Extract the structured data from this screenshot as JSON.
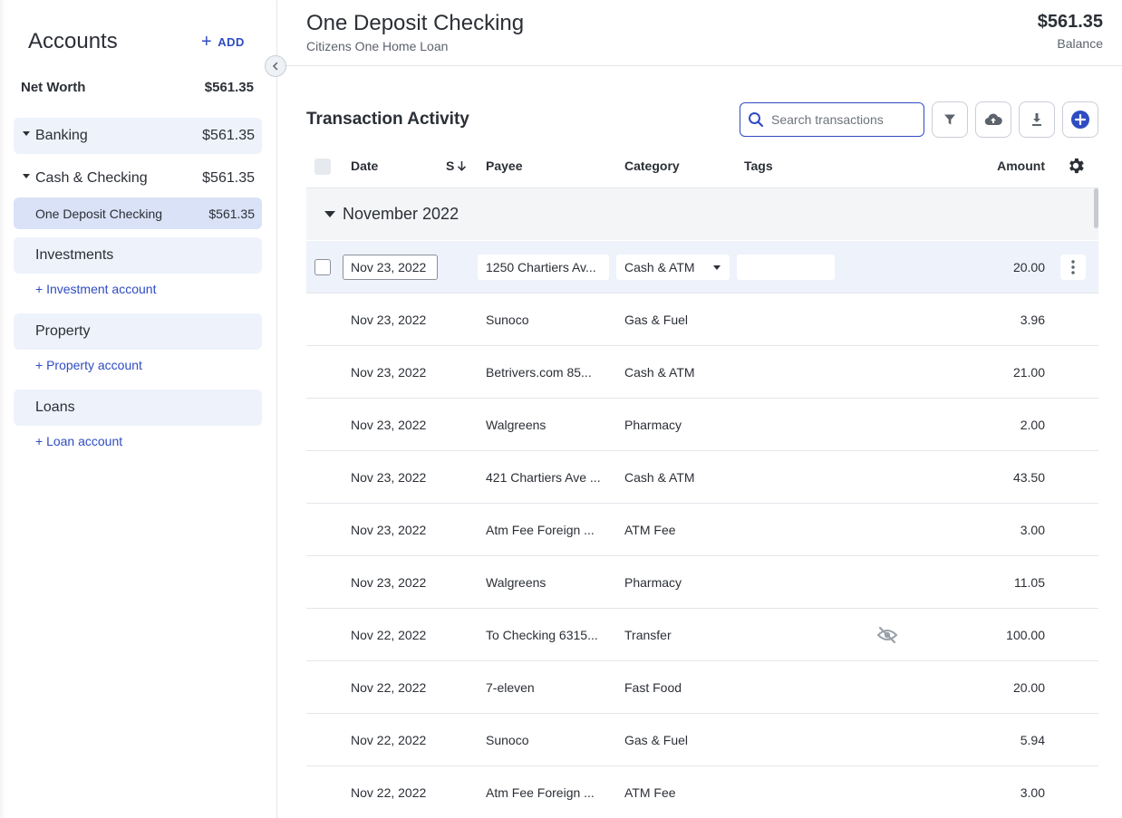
{
  "sidebar": {
    "title": "Accounts",
    "add_label": "ADD",
    "net_worth": {
      "label": "Net Worth",
      "amount": "$561.35"
    },
    "banking": {
      "label": "Banking",
      "amount": "$561.35"
    },
    "cash_checking": {
      "label": "Cash & Checking",
      "amount": "$561.35"
    },
    "selected_account": {
      "label": "One Deposit Checking",
      "amount": "$561.35"
    },
    "investments": {
      "label": "Investments",
      "add_link": "+ Investment account"
    },
    "property": {
      "label": "Property",
      "add_link": "+ Property account"
    },
    "loans": {
      "label": "Loans",
      "add_link": "+ Loan account"
    }
  },
  "header": {
    "account_name": "One Deposit Checking",
    "institution": "Citizens One Home Loan",
    "balance": "$561.35",
    "balance_label": "Balance"
  },
  "activity": {
    "title": "Transaction Activity",
    "search_placeholder": "Search transactions",
    "columns": {
      "date": "Date",
      "status": "S",
      "payee": "Payee",
      "category": "Category",
      "tags": "Tags",
      "amount": "Amount"
    },
    "month": "November 2022",
    "editing": {
      "date": "Nov 23, 2022",
      "payee": "1250 Chartiers Av...",
      "category": "Cash & ATM",
      "amount": "20.00"
    },
    "rows": [
      {
        "date": "Nov 23, 2022",
        "payee": "Sunoco",
        "category": "Gas & Fuel",
        "amount": "3.96"
      },
      {
        "date": "Nov 23, 2022",
        "payee": "Betrivers.com 85...",
        "category": "Cash & ATM",
        "amount": "21.00"
      },
      {
        "date": "Nov 23, 2022",
        "payee": "Walgreens",
        "category": "Pharmacy",
        "amount": "2.00"
      },
      {
        "date": "Nov 23, 2022",
        "payee": "421 Chartiers Ave ...",
        "category": "Cash & ATM",
        "amount": "43.50"
      },
      {
        "date": "Nov 23, 2022",
        "payee": "Atm Fee Foreign ...",
        "category": "ATM Fee",
        "amount": "3.00"
      },
      {
        "date": "Nov 23, 2022",
        "payee": "Walgreens",
        "category": "Pharmacy",
        "amount": "11.05"
      },
      {
        "date": "Nov 22, 2022",
        "payee": "To Checking 6315...",
        "category": "Transfer",
        "amount": "100.00",
        "icon": "hidden-eye-icon"
      },
      {
        "date": "Nov 22, 2022",
        "payee": "7-eleven",
        "category": "Fast Food",
        "amount": "20.00"
      },
      {
        "date": "Nov 22, 2022",
        "payee": "Sunoco",
        "category": "Gas & Fuel",
        "amount": "5.94"
      },
      {
        "date": "Nov 22, 2022",
        "payee": "Atm Fee Foreign ...",
        "category": "ATM Fee",
        "amount": "3.00"
      }
    ]
  },
  "colors": {
    "accent": "#2f4cc2",
    "selected_bg": "#d9e2f6",
    "group_bg": "#edf2fb"
  }
}
